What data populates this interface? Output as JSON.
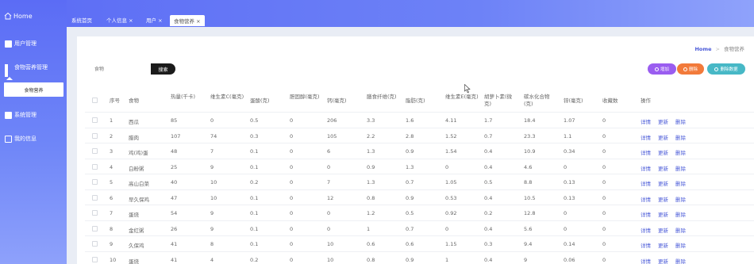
{
  "sidebar": {
    "home": "Home",
    "items": [
      {
        "label": "用户管理",
        "icon": "user-card-icon"
      },
      {
        "label": "食物营养管理",
        "icon": "grid-icon"
      },
      {
        "label": "食物营养",
        "sub": true
      },
      {
        "label": "系统管理",
        "icon": "system-icon"
      },
      {
        "label": "我的信息",
        "icon": "info-icon"
      }
    ]
  },
  "tabs": [
    {
      "label": "系统首页",
      "active": false
    },
    {
      "label": "个人信息 ×",
      "active": false
    },
    {
      "label": "用户 ×",
      "active": false
    },
    {
      "label": "食物营养 ×",
      "active": true
    }
  ],
  "breadcrumb": {
    "home": "Home",
    "current": "食物营养"
  },
  "search": {
    "placeholder": "食物",
    "button": "搜索"
  },
  "actions": {
    "add": "增加",
    "delete": "删除",
    "batch": "删除数据"
  },
  "table": {
    "headers": [
      "序号",
      "食物",
      "热量(千卡)",
      "维生素C(毫克)",
      "蛋酸(克)",
      "胆固醇(毫克)",
      "钙(毫克)",
      "膳食纤维(克)",
      "脂肪(克)",
      "维生素E(毫克)",
      "胡萝卜素(微克)",
      "碳水化合物(克)",
      "锌(毫克)",
      "收藏数",
      "操作"
    ],
    "row_actions": [
      "详情",
      "更新",
      "删除"
    ],
    "rows": [
      [
        "1",
        "西瓜",
        "85",
        "0",
        "0.5",
        "0",
        "206",
        "3.3",
        "1.6",
        "4.11",
        "1.7",
        "18.4",
        "1.07",
        "0"
      ],
      [
        "2",
        "腊肉",
        "107",
        "74",
        "0.3",
        "0",
        "105",
        "2.2",
        "2.8",
        "1.52",
        "0.7",
        "23.3",
        "1.1",
        "0"
      ],
      [
        "3",
        "鸡(鸡)蛋",
        "48",
        "7",
        "0.1",
        "0",
        "6",
        "1.3",
        "0.9",
        "1.54",
        "0.4",
        "10.9",
        "0.34",
        "0"
      ],
      [
        "4",
        "白粉粥",
        "25",
        "9",
        "0.1",
        "0",
        "0",
        "0.9",
        "1.3",
        "0",
        "0.4",
        "4.6",
        "0",
        "0"
      ],
      [
        "5",
        "高山白菜",
        "40",
        "10",
        "0.2",
        "0",
        "7",
        "1.3",
        "0.7",
        "1.05",
        "0.5",
        "8.8",
        "0.13",
        "0"
      ],
      [
        "6",
        "早久保鸡",
        "47",
        "10",
        "0.1",
        "0",
        "12",
        "0.8",
        "0.9",
        "0.53",
        "0.4",
        "10.5",
        "0.13",
        "0"
      ],
      [
        "7",
        "蛋烧",
        "54",
        "9",
        "0.1",
        "0",
        "0",
        "1.2",
        "0.5",
        "0.92",
        "0.2",
        "12.8",
        "0",
        "0"
      ],
      [
        "8",
        "金红粥",
        "26",
        "9",
        "0.1",
        "0",
        "0",
        "1",
        "0.7",
        "0",
        "0.4",
        "5.6",
        "0",
        "0"
      ],
      [
        "9",
        "久保鸡",
        "41",
        "8",
        "0.1",
        "0",
        "10",
        "0.6",
        "0.6",
        "1.15",
        "0.3",
        "9.4",
        "0.14",
        "0"
      ],
      [
        "10",
        "蛋烧",
        "41",
        "4",
        "0.2",
        "0",
        "10",
        "0.8",
        "0.9",
        "1",
        "0.4",
        "9",
        "0.06",
        "0"
      ]
    ]
  }
}
